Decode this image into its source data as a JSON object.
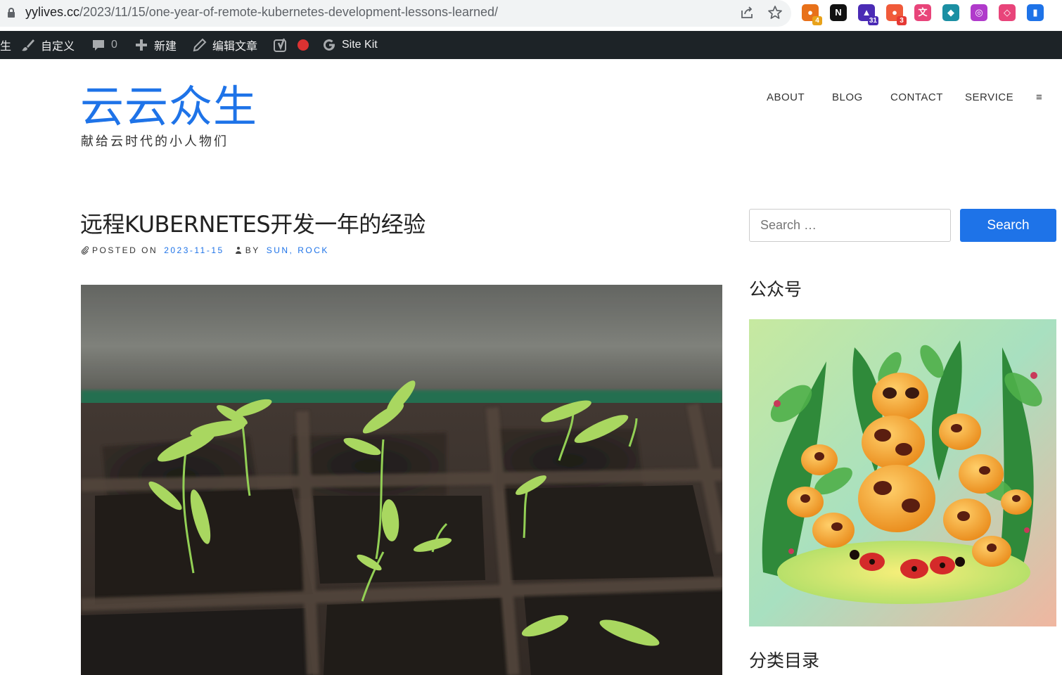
{
  "browser": {
    "url_host": "yylives.cc",
    "url_path": "/2023/11/15/one-year-of-remote-kubernetes-development-lessons-learned/",
    "extensions": [
      {
        "name": "ext-1",
        "badge": "4",
        "color": "#e8711a"
      },
      {
        "name": "notion-ext",
        "badge": "",
        "color": "#111111"
      },
      {
        "name": "ext-3",
        "badge": "31",
        "color": "#4b2bb5"
      },
      {
        "name": "ext-4",
        "badge": "3",
        "color": "#f05a3a"
      },
      {
        "name": "translate-ext",
        "badge": "",
        "color": "#e8447a"
      },
      {
        "name": "ext-6",
        "badge": "",
        "color": "#1b8fa3"
      },
      {
        "name": "ext-7",
        "badge": "",
        "color": "#b03acb"
      },
      {
        "name": "ext-8",
        "badge": "",
        "color": "#e8447a"
      },
      {
        "name": "ext-9",
        "badge": "",
        "color": "#1e73e8"
      }
    ]
  },
  "adminbar": {
    "site_fragment": "生",
    "customize": "自定义",
    "comments_count": "0",
    "new": "新建",
    "edit_post": "编辑文章",
    "site_kit": "Site Kit"
  },
  "site": {
    "title": "云云众生",
    "description": "献给云时代的小人物们"
  },
  "nav": {
    "items": [
      "ABOUT",
      "BLOG",
      "CONTACT",
      "SERVICE"
    ],
    "menu_toggle": "≡"
  },
  "post": {
    "title": "远程KUBERNETES开发一年的经验",
    "posted_on_label": "POSTED ON",
    "date": "2023-11-15",
    "by_label": "BY",
    "author_1": "SUN",
    "author_sep": ", ",
    "author_2": "ROCK"
  },
  "sidebar": {
    "search_placeholder": "Search …",
    "search_button": "Search",
    "widget_1_title": "公众号",
    "widget_2_title": "分类目录"
  },
  "colors": {
    "accent": "#1e73e8",
    "adminbar_bg": "#1d2327"
  }
}
